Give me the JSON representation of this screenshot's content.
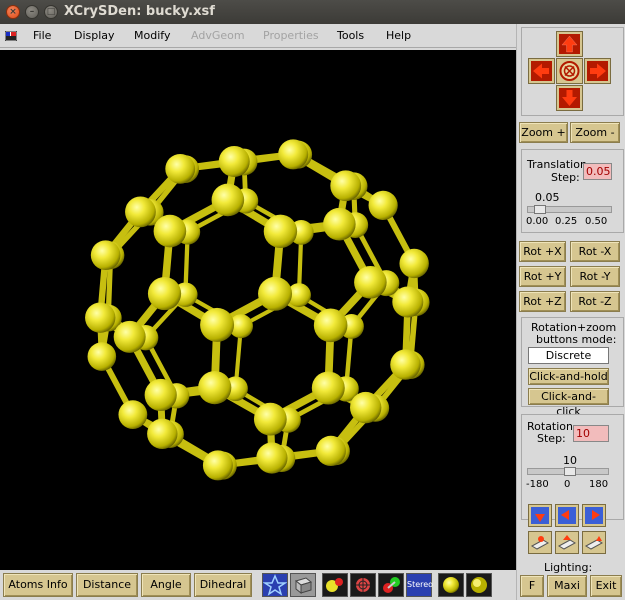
{
  "window": {
    "title": "XCrySDen: bucky.xsf",
    "close_glyph": "×",
    "min_glyph": "–",
    "max_glyph": "□"
  },
  "menubar": {
    "items": [
      {
        "label": "File",
        "disabled": false
      },
      {
        "label": "Display",
        "disabled": false
      },
      {
        "label": "Modify",
        "disabled": false
      },
      {
        "label": "AdvGeom",
        "disabled": true
      },
      {
        "label": "Properties",
        "disabled": true
      },
      {
        "label": "Tools",
        "disabled": false
      },
      {
        "label": "Help",
        "disabled": false
      }
    ]
  },
  "viewport": {
    "background": "#000000",
    "atom_color": "#e8e029",
    "bond_color": "#c7bf10"
  },
  "bottombar": {
    "atoms_info": "Atoms Info",
    "distance": "Distance",
    "angle": "Angle",
    "dihedral": "Dihedral",
    "icon_stereo": "Stereo"
  },
  "rpanel": {
    "zoom_plus": "Zoom +",
    "zoom_minus": "Zoom -",
    "translation_step_label_1": "Translation",
    "translation_step_label_2": "Step:",
    "translation_step_value": "0.05",
    "translation_slider_value": "0.05",
    "translation_ticks": [
      "0.00",
      "0.25",
      "0.50"
    ],
    "translation_slider_fraction": 0.1,
    "rot_x_plus": "Rot +X",
    "rot_x_minus": "Rot -X",
    "rot_y_plus": "Rot +Y",
    "rot_y_minus": "Rot -Y",
    "rot_z_plus": "Rot +Z",
    "rot_z_minus": "Rot -Z",
    "mode_label_1": "Rotation+zoom",
    "mode_label_2": "buttons mode:",
    "mode_discrete": "Discrete",
    "mode_click_hold": "Click-and-hold",
    "mode_click_click": "Click-and-click",
    "rotation_step_label_1": "Rotation",
    "rotation_step_label_2": "Step:",
    "rotation_step_value": "10",
    "rotation_slider_value": "10",
    "rotation_ticks": [
      "-180",
      "0",
      "180"
    ],
    "rotation_slider_fraction": 0.528,
    "lighting_label": "Lighting:",
    "f_button": "F",
    "maxi_button": "Maxi",
    "exit_button": "Exit",
    "accent": "#d6c690"
  }
}
